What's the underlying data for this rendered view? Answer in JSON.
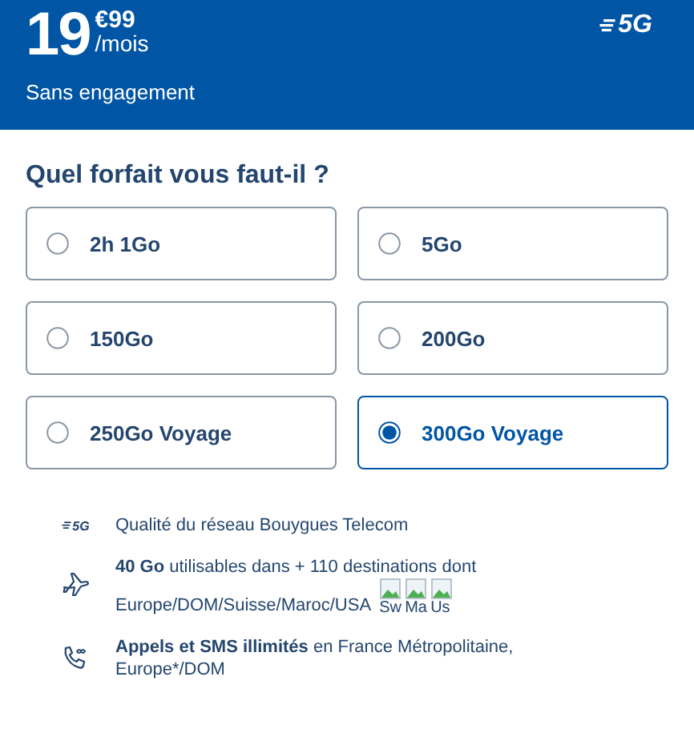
{
  "header": {
    "price_whole": "19",
    "price_cents": "€99",
    "price_period": "/mois",
    "network_badge": "5G",
    "commitment": "Sans engagement"
  },
  "question": "Quel forfait vous faut-il ?",
  "options": [
    {
      "label": "2h 1Go",
      "selected": false
    },
    {
      "label": "5Go",
      "selected": false
    },
    {
      "label": "150Go",
      "selected": false
    },
    {
      "label": "200Go",
      "selected": false
    },
    {
      "label": "250Go Voyage",
      "selected": false
    },
    {
      "label": "300Go Voyage",
      "selected": true
    }
  ],
  "features": [
    {
      "kind": "network",
      "badge": "5G",
      "text": "Qualité du réseau Bouygues Telecom"
    },
    {
      "kind": "travel",
      "text": "**40 Go** utilisables dans + 110 destinations dont",
      "text_2": "Europe/DOM/Suisse/Maroc/USA",
      "flags": [
        "Sw",
        "Ma",
        "Us"
      ]
    },
    {
      "kind": "calls",
      "text": "**Appels et SMS illimités** en France Métropolitaine,",
      "text_2": "Europe*/DOM"
    }
  ]
}
